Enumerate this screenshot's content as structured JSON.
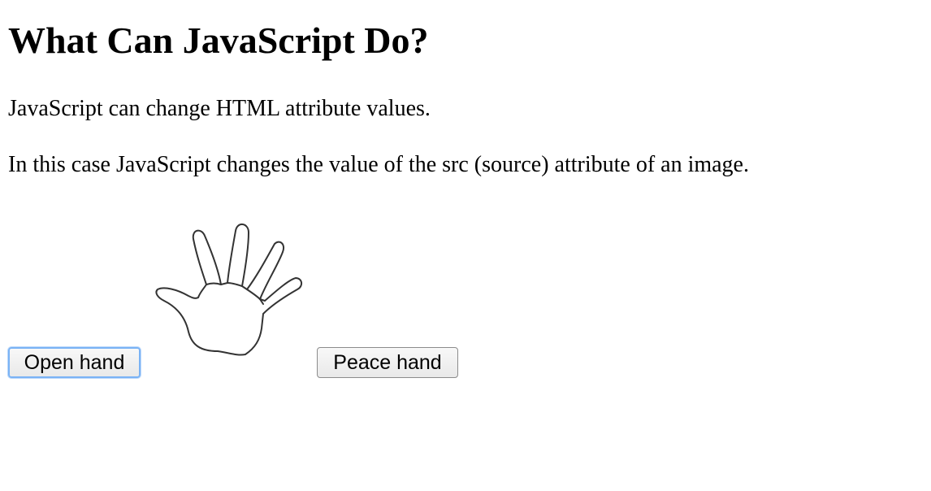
{
  "page": {
    "heading": "What Can JavaScript Do?",
    "paragraph_1": "JavaScript can change HTML attribute values.",
    "paragraph_2": "In this case JavaScript changes the value of the src (source) attribute of an image."
  },
  "controls": {
    "open_hand_label": "Open hand",
    "peace_hand_label": "Peace hand"
  },
  "image": {
    "icon": "open-hand-icon",
    "stroke_color": "#333333"
  },
  "colors": {
    "focus_ring": "#7ab3f5",
    "button_border": "#8c8c8c"
  }
}
